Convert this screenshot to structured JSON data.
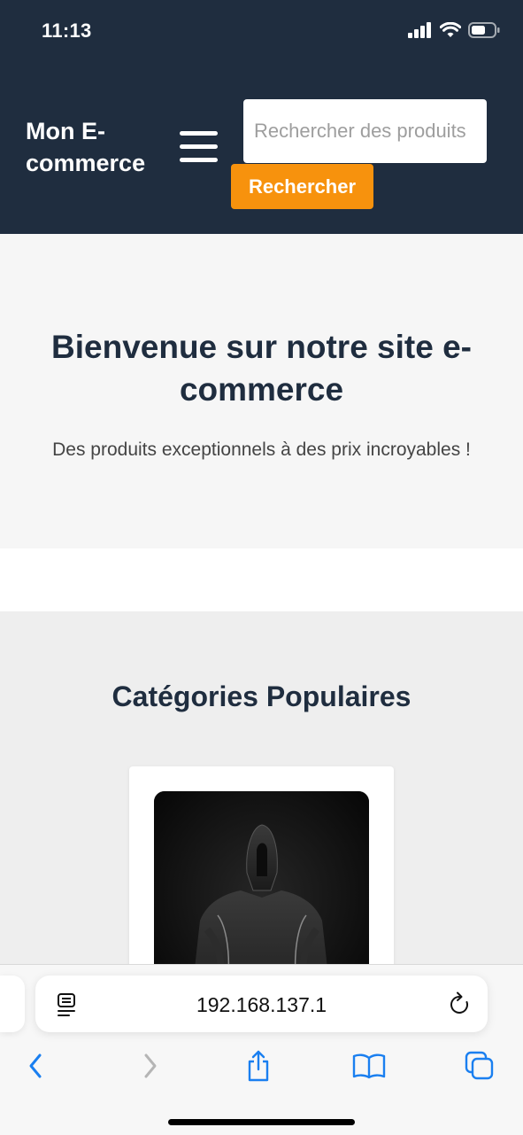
{
  "status_bar": {
    "time": "11:13"
  },
  "header": {
    "logo": "Mon E-commerce",
    "search": {
      "placeholder": "Rechercher des produits",
      "value": "",
      "button_label": "Rechercher"
    }
  },
  "hero": {
    "title": "Bienvenue sur notre site e-commerce",
    "subtitle": "Des produits exceptionnels à des prix incroyables !"
  },
  "categories": {
    "title": "Catégories Populaires"
  },
  "browser": {
    "url": "192.168.137.1",
    "toolbar": [
      "back-icon",
      "forward-icon",
      "share-icon",
      "bookmarks-icon",
      "tabs-icon"
    ]
  },
  "colors": {
    "header_bg": "#1f2d3f",
    "accent": "#f7920d",
    "link_blue": "#1a7ff0"
  }
}
